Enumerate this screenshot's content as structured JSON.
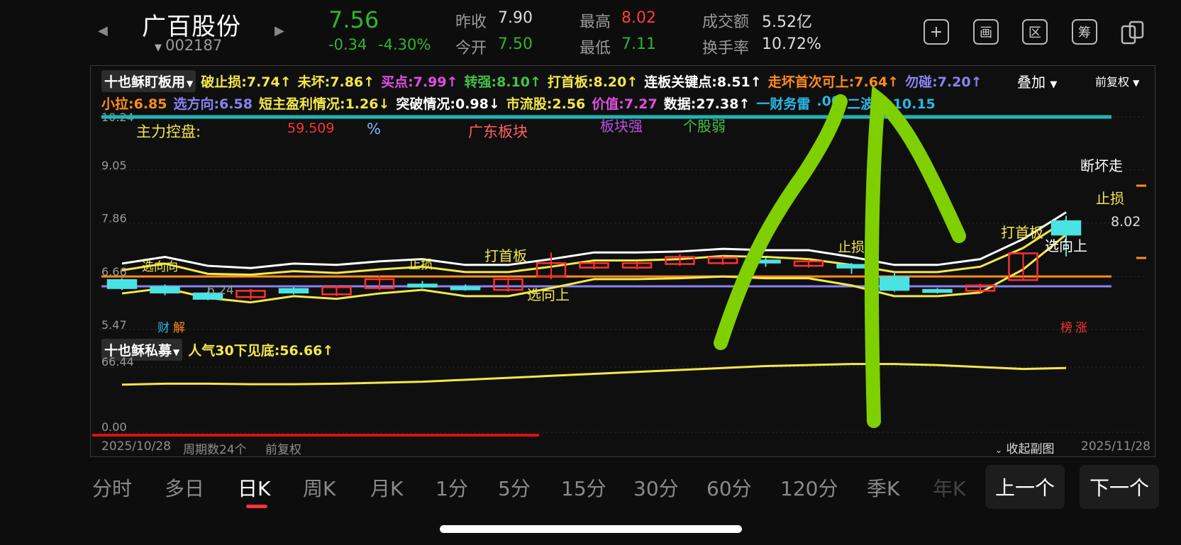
{
  "stock": {
    "name": "广百股份",
    "code": "002187",
    "price": "7.56",
    "change": "-0.34",
    "change_pct": "-4.30%"
  },
  "quote": {
    "prev_close_label": "昨收",
    "prev_close": "7.90",
    "open_label": "今开",
    "open": "7.50",
    "high_label": "最高",
    "high": "8.02",
    "low_label": "最低",
    "low": "7.11",
    "amount_label": "成交额",
    "amount": "5.52亿",
    "turnover_label": "换手率",
    "turnover": "10.72%"
  },
  "header_icons": [
    "plus-icon",
    "screen-icon",
    "region-icon",
    "chip-icon",
    "multi-window-icon"
  ],
  "header_icon_glyphs": [
    "+",
    "画",
    "区",
    "筹",
    ""
  ],
  "main_indicator": {
    "selector": "十也稣盯板用",
    "row1": [
      {
        "text": "破止损:7.74↑",
        "color": "#f3e74a"
      },
      {
        "text": "未坏:7.86↑",
        "color": "#f3e74a"
      },
      {
        "text": "买点:7.99↑",
        "color": "#e04ee0"
      },
      {
        "text": "转强:8.10↑",
        "color": "#46c146"
      },
      {
        "text": "打首板:8.20↑",
        "color": "#f3e74a"
      },
      {
        "text": "连板关键点:8.51↑",
        "color": "#ffffff"
      },
      {
        "text": "走坏首次可上:7.64↑",
        "color": "#ff8c1a"
      },
      {
        "text": "勿碰:7.20↑",
        "color": "#8a82f0"
      }
    ],
    "row2": [
      {
        "text": "小拉:6.85",
        "color": "#ff8c1a"
      },
      {
        "text": "选方向:6.58",
        "color": "#8a82f0"
      },
      {
        "text": "短主盈利情况:1.26↓",
        "color": "#f3e74a"
      },
      {
        "text": "突破情况:0.98↓",
        "color": "#ffffff"
      },
      {
        "text": "市流股:2.56",
        "color": "#f3e74a"
      },
      {
        "text": "价值:7.27",
        "color": "#e04ee0"
      },
      {
        "text": "数据:27.38↑",
        "color": "#ffffff"
      },
      {
        "text": "一财务雷",
        "color": "#2ab7e6"
      },
      {
        "text": ".00",
        "color": "#2ab7e6"
      },
      {
        "text": "二波底:10.15",
        "color": "#2ab7e6"
      }
    ],
    "overlay": "叠加",
    "adjust": "前复权"
  },
  "chart_labels": {
    "main_force": "主力控盘:",
    "main_force_val": "59.509",
    "pct": "%",
    "sector": "广东板块",
    "sector_strong": "板块强",
    "stock_weak": "个股弱",
    "duanhuaizou": "断坏走",
    "zhisun": "止损",
    "dashouban": "打首板",
    "xuanxiangshang": "选向上",
    "price_marker": "8.02",
    "low_marker": "6.24",
    "cai": "财",
    "jie": "解",
    "bang": "榜",
    "zhang": "涨",
    "xuanxiang_left": "选向向",
    "zhisun_mid": "止损"
  },
  "sub_indicator": {
    "selector": "十也稣私募",
    "text": "人气30下见底:56.66↑",
    "color": "#f3e74a"
  },
  "chart_data": [
    {
      "type": "candlestick",
      "y_ticks": [
        "10.24",
        "9.05",
        "7.86",
        "6.66",
        "5.47"
      ],
      "ylim": [
        5.47,
        10.24
      ],
      "candles": [
        {
          "o": 6.58,
          "c": 6.4,
          "h": 6.62,
          "l": 6.36
        },
        {
          "o": 6.42,
          "c": 6.3,
          "h": 6.48,
          "l": 6.24
        },
        {
          "o": 6.28,
          "c": 6.16,
          "h": 6.32,
          "l": 6.13
        },
        {
          "o": 6.2,
          "c": 6.34,
          "h": 6.38,
          "l": 6.14
        },
        {
          "o": 6.38,
          "c": 6.3,
          "h": 6.42,
          "l": 6.26
        },
        {
          "o": 6.26,
          "c": 6.42,
          "h": 6.46,
          "l": 6.22
        },
        {
          "o": 6.4,
          "c": 6.6,
          "h": 6.68,
          "l": 6.36
        },
        {
          "o": 6.48,
          "c": 6.44,
          "h": 6.56,
          "l": 6.4
        },
        {
          "o": 6.42,
          "c": 6.4,
          "h": 6.48,
          "l": 6.34
        },
        {
          "o": 6.36,
          "c": 6.6,
          "h": 6.66,
          "l": 6.32
        },
        {
          "o": 6.66,
          "c": 6.96,
          "h": 7.2,
          "l": 6.6
        },
        {
          "o": 6.86,
          "c": 6.96,
          "h": 7.0,
          "l": 6.82
        },
        {
          "o": 6.86,
          "c": 6.96,
          "h": 7.0,
          "l": 6.82
        },
        {
          "o": 6.94,
          "c": 7.1,
          "h": 7.16,
          "l": 6.9
        },
        {
          "o": 6.96,
          "c": 7.08,
          "h": 7.12,
          "l": 6.92
        },
        {
          "o": 7.02,
          "c": 6.98,
          "h": 7.08,
          "l": 6.88
        },
        {
          "o": 6.9,
          "c": 7.0,
          "h": 7.04,
          "l": 6.86
        },
        {
          "o": 6.92,
          "c": 6.86,
          "h": 6.96,
          "l": 6.72
        },
        {
          "o": 6.64,
          "c": 6.36,
          "h": 6.76,
          "l": 6.32
        },
        {
          "o": 6.36,
          "c": 6.34,
          "h": 6.4,
          "l": 6.28
        },
        {
          "o": 6.34,
          "c": 6.46,
          "h": 6.5,
          "l": 6.3
        },
        {
          "o": 6.58,
          "c": 7.18,
          "h": 7.2,
          "l": 6.56
        },
        {
          "o": 7.9,
          "c": 7.6,
          "h": 8.02,
          "l": 7.11
        }
      ],
      "lines": [
        {
          "name": "连板关键点",
          "color": "#ffffff",
          "values": [
            6.95,
            7.1,
            6.9,
            6.85,
            6.95,
            6.92,
            7.0,
            7.05,
            6.92,
            6.92,
            7.05,
            7.2,
            7.2,
            7.22,
            7.28,
            7.25,
            7.25,
            7.1,
            6.92,
            6.92,
            7.05,
            7.5,
            8.1
          ]
        },
        {
          "name": "打首板",
          "color": "#f3e74a",
          "values": [
            6.8,
            6.95,
            6.72,
            6.7,
            6.78,
            6.74,
            6.82,
            6.88,
            6.76,
            6.76,
            6.88,
            7.02,
            7.02,
            7.05,
            7.12,
            7.1,
            7.05,
            6.92,
            6.76,
            6.76,
            6.88,
            7.3,
            7.92
          ]
        },
        {
          "name": "选向上",
          "color": "#f3e74a",
          "values": [
            6.28,
            6.4,
            6.18,
            6.08,
            6.22,
            6.16,
            6.28,
            6.36,
            6.22,
            6.22,
            6.4,
            6.6,
            6.6,
            6.62,
            6.66,
            6.62,
            6.62,
            6.46,
            6.22,
            6.22,
            6.3,
            6.82,
            7.6
          ]
        }
      ],
      "hlines": [
        {
          "value": 10.24,
          "color": "#1fb7b7"
        },
        {
          "value": 6.66,
          "color": "#ff8c1a"
        },
        {
          "value": 6.44,
          "color": "#8a82f0"
        }
      ]
    },
    {
      "type": "line",
      "y_ticks": [
        "66.44",
        "0.00"
      ],
      "ylim": [
        0.0,
        66.44
      ],
      "series": [
        {
          "name": "人气30下见底",
          "color": "#f3e74a",
          "values": [
            50,
            51,
            51,
            50.5,
            50.5,
            51,
            52,
            53,
            55,
            57,
            59,
            61,
            63,
            65,
            67,
            69,
            70,
            71,
            71,
            70,
            68,
            66,
            67
          ]
        }
      ]
    }
  ],
  "footer": {
    "start_date": "2025/10/28",
    "periods": "周期数24个",
    "adjust": "前复权",
    "collapse": "收起副图",
    "end_date": "2025/11/28"
  },
  "tabs": [
    "分时",
    "多日",
    "日K",
    "周K",
    "月K",
    "1分",
    "5分",
    "15分",
    "30分",
    "60分",
    "120分",
    "季K",
    "年K"
  ],
  "active_tab": "日K",
  "nav": {
    "prev": "上一个",
    "next": "下一个"
  }
}
